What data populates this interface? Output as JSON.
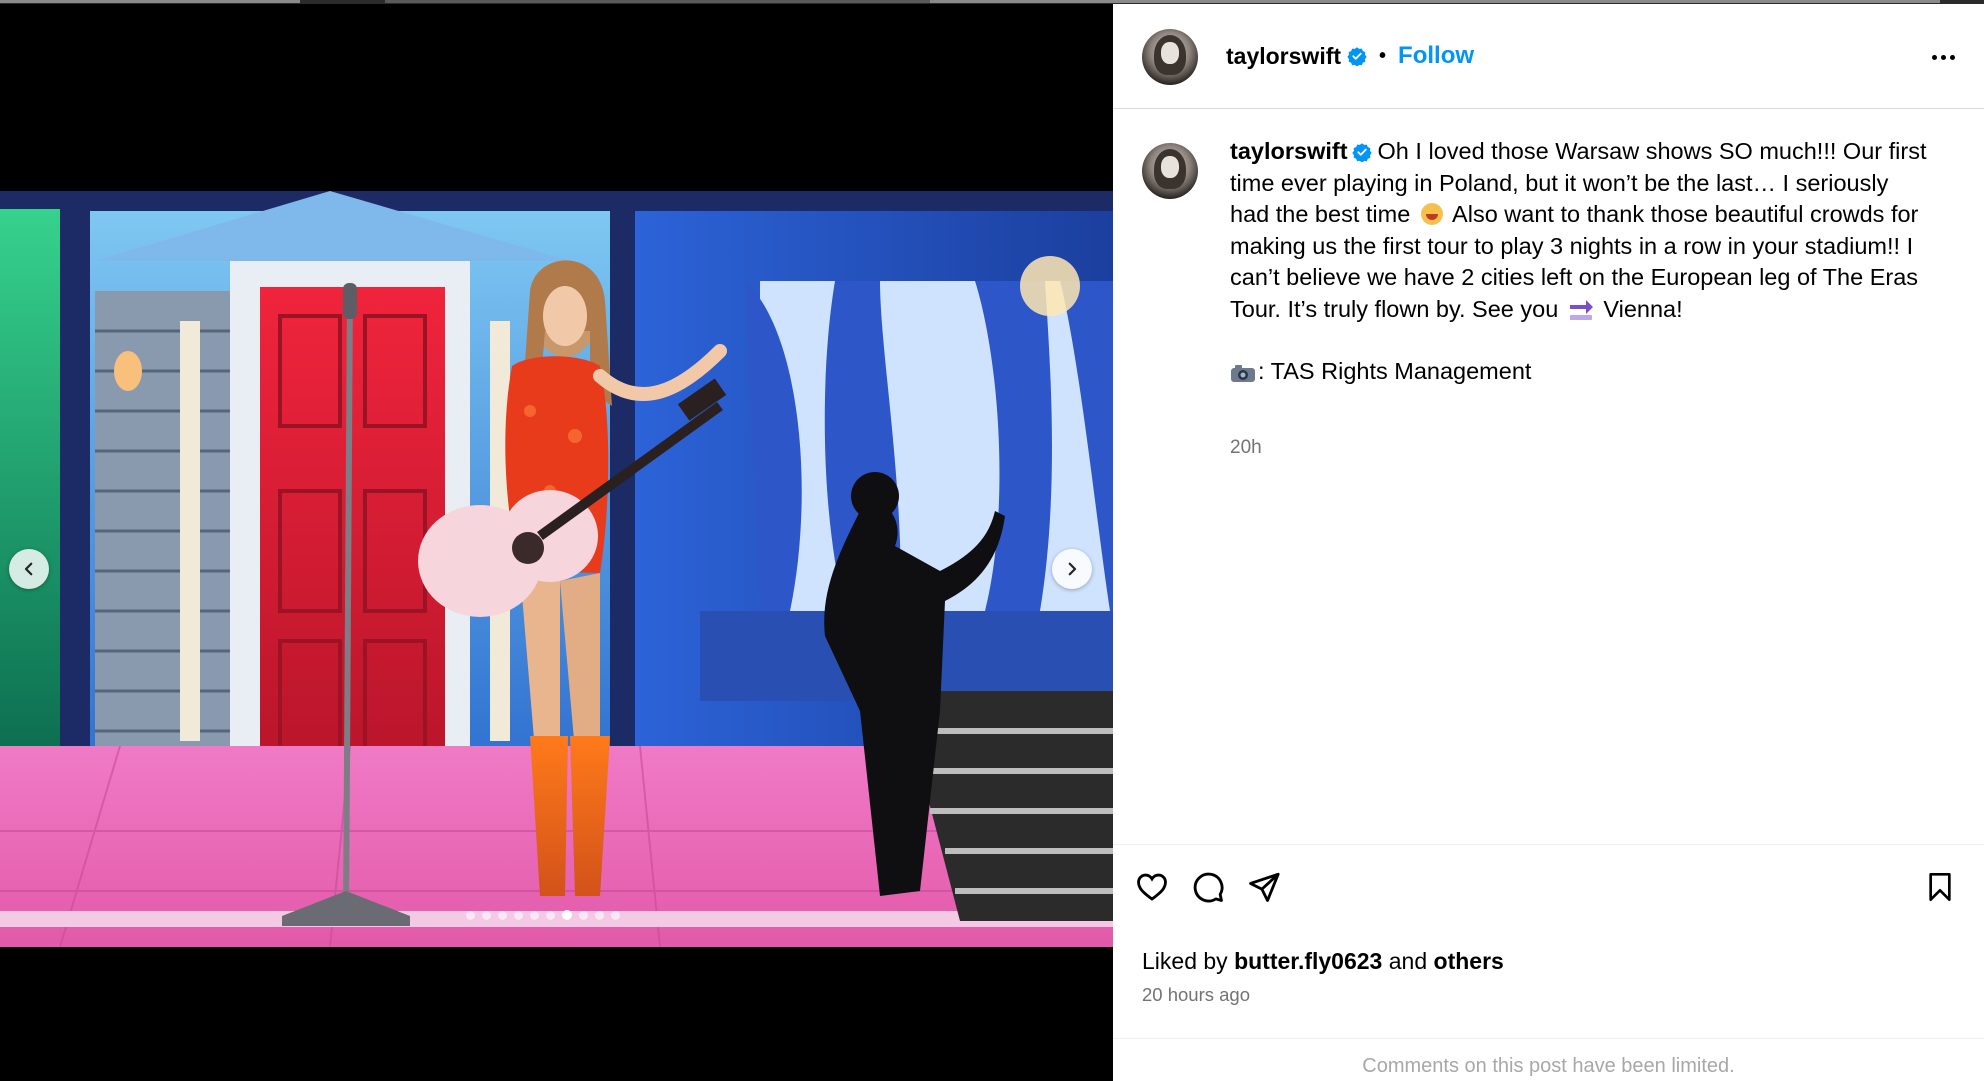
{
  "post": {
    "username": "taylorswift",
    "verified": true,
    "follow_label": "Follow",
    "separator": "•",
    "caption_part1": "Oh I loved those Warsaw shows SO much!!! Our first time ever playing in Poland, but it won’t be the last… I seriously had the best time ",
    "caption_part2": " Also want to thank those beautiful crowds for making us the first tour to play 3 nights in a row in your stadium!! I can’t believe we have 2 cities left on the European leg of The Eras Tour. It’s truly flown by. See you ",
    "caption_part3": " Vienna!",
    "credit_text": ": TAS Rights Management",
    "caption_time": "20h",
    "liked_by_prefix": "Liked by ",
    "liked_by_user": "butter.fly0623",
    "liked_by_and": " and ",
    "liked_by_others": "others",
    "time_ago": "20 hours ago",
    "comments_notice": "Comments on this post have been limited."
  },
  "carousel": {
    "total_slides": 10,
    "active_index": 6
  },
  "icons": {
    "prev": "chevron-left-icon",
    "next": "chevron-right-icon",
    "like": "heart-icon",
    "comment": "comment-icon",
    "share": "share-icon",
    "save": "bookmark-icon",
    "more": "more-horizontal-icon",
    "verified": "verified-badge-icon"
  },
  "colors": {
    "accent": "#0095f6",
    "muted": "#737373",
    "stage_pink": "#e46cb7",
    "door_red": "#d3283a"
  }
}
